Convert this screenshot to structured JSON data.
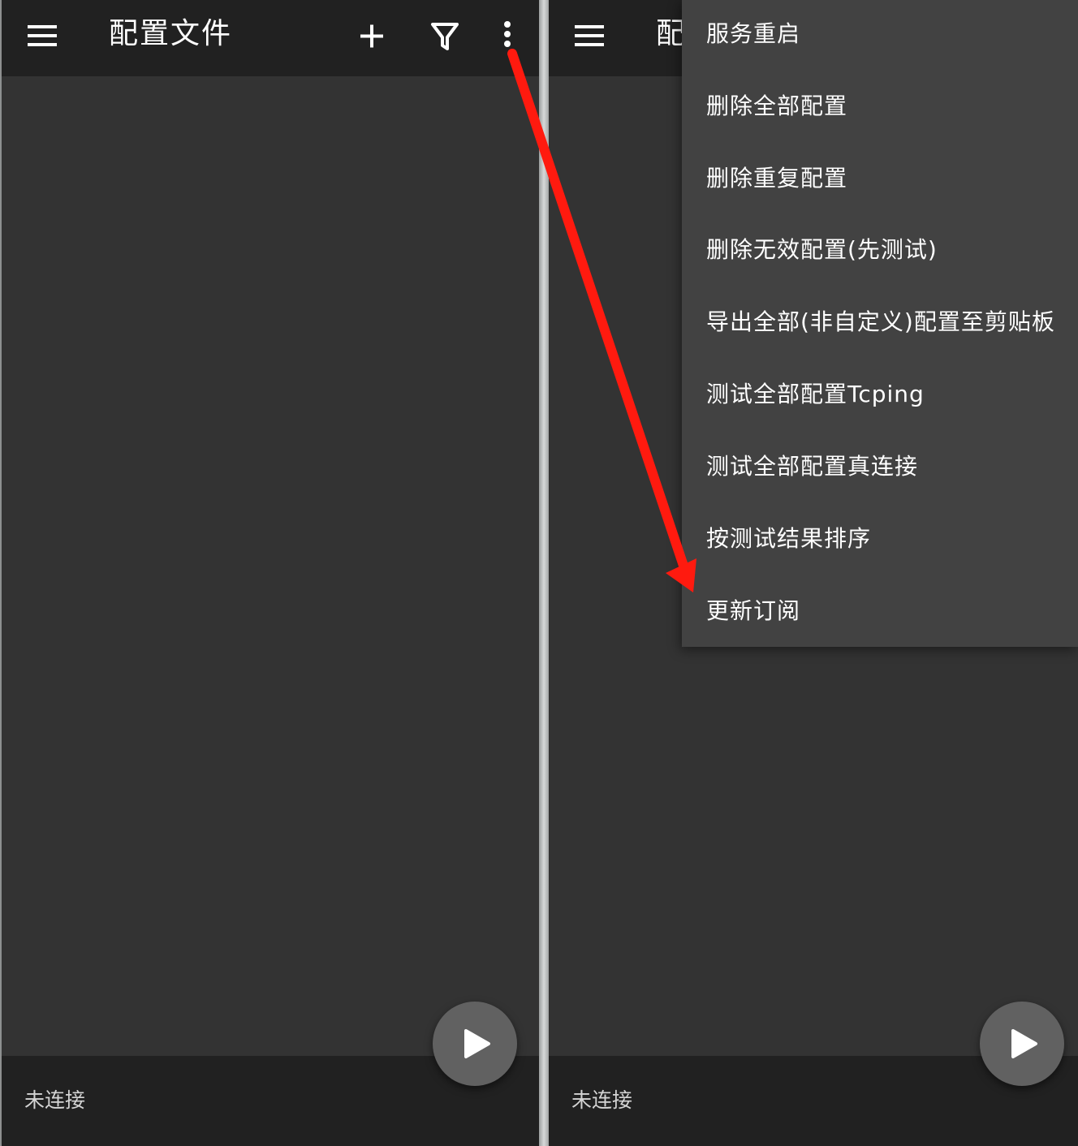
{
  "app": {
    "title": "配置文件",
    "title_truncated": "配",
    "status": "未连接"
  },
  "toolbar": {
    "menu_icon": "hamburger-menu-icon",
    "add_icon": "plus-icon",
    "filter_icon": "filter-funnel-icon",
    "overflow_icon": "more-vertical-icon"
  },
  "fab": {
    "icon": "play-icon"
  },
  "overflow_menu": {
    "items": [
      "服务重启",
      "删除全部配置",
      "删除重复配置",
      "删除无效配置(先测试)",
      "导出全部(非自定义)配置至剪贴板",
      "测试全部配置Tcping",
      "测试全部配置真连接",
      "按测试结果排序",
      "更新订阅"
    ]
  },
  "colors": {
    "appbar": "#212121",
    "background": "#333333",
    "menu_bg": "#424242",
    "fab": "#616161",
    "annotation_arrow": "#ff1a0f"
  }
}
